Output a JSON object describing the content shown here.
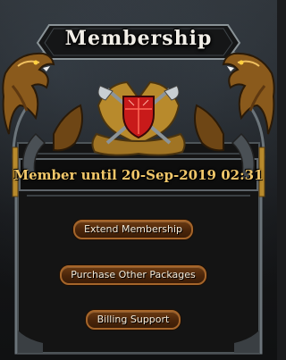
{
  "panel": {
    "title": "Membership",
    "member_status": "Member until 20-Sep-2019 02:31"
  },
  "buttons": {
    "extend": "Extend Membership",
    "packages": "Purchase Other Packages",
    "billing": "Billing Support"
  },
  "colors": {
    "accent_gold": "#f1c76a",
    "button_border": "#a5652a",
    "emblem_red": "#c81a1a"
  }
}
